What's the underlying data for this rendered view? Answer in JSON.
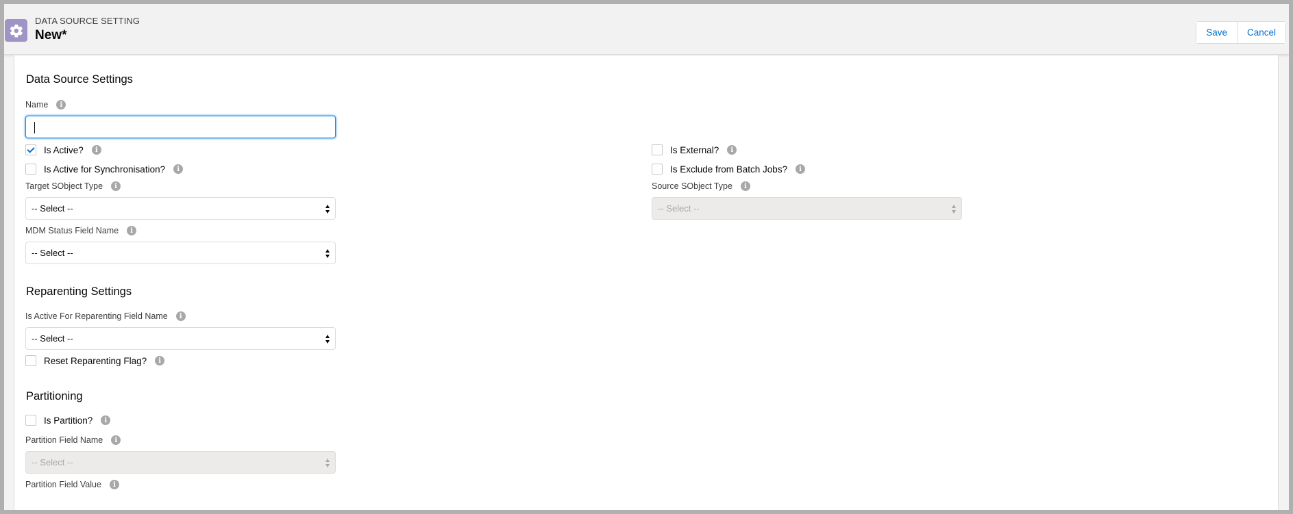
{
  "header": {
    "eyebrow": "DATA SOURCE SETTING",
    "title": "New*",
    "icon": "gear-icon",
    "save_label": "Save",
    "cancel_label": "Cancel"
  },
  "sections": {
    "data_source": {
      "title": "Data Source Settings"
    },
    "reparenting": {
      "title": "Reparenting Settings"
    },
    "partitioning": {
      "title": "Partitioning"
    }
  },
  "fields": {
    "name": {
      "label": "Name",
      "value": ""
    },
    "is_active": {
      "label": "Is Active?",
      "checked": true
    },
    "is_external": {
      "label": "Is External?",
      "checked": false
    },
    "is_active_sync": {
      "label": "Is Active for Synchronisation?",
      "checked": false
    },
    "is_exclude_batch": {
      "label": "Is Exclude from Batch Jobs?",
      "checked": false
    },
    "target_sobject": {
      "label": "Target SObject Type",
      "value": "-- Select --"
    },
    "source_sobject": {
      "label": "Source SObject Type",
      "value": "-- Select --",
      "disabled": true
    },
    "mdm_status": {
      "label": "MDM Status Field Name",
      "value": "-- Select --"
    },
    "reparenting_field": {
      "label": "Is Active For Reparenting Field Name",
      "value": "-- Select --"
    },
    "reset_reparenting": {
      "label": "Reset Reparenting Flag?",
      "checked": false
    },
    "is_partition": {
      "label": "Is Partition?",
      "checked": false
    },
    "partition_field_name": {
      "label": "Partition Field Name",
      "value": "-- Select --",
      "disabled": true
    },
    "partition_field_value": {
      "label": "Partition Field Value"
    }
  },
  "colors": {
    "brand_icon": "#a094c6",
    "link": "#0070d2",
    "focus": "#1589ee"
  }
}
